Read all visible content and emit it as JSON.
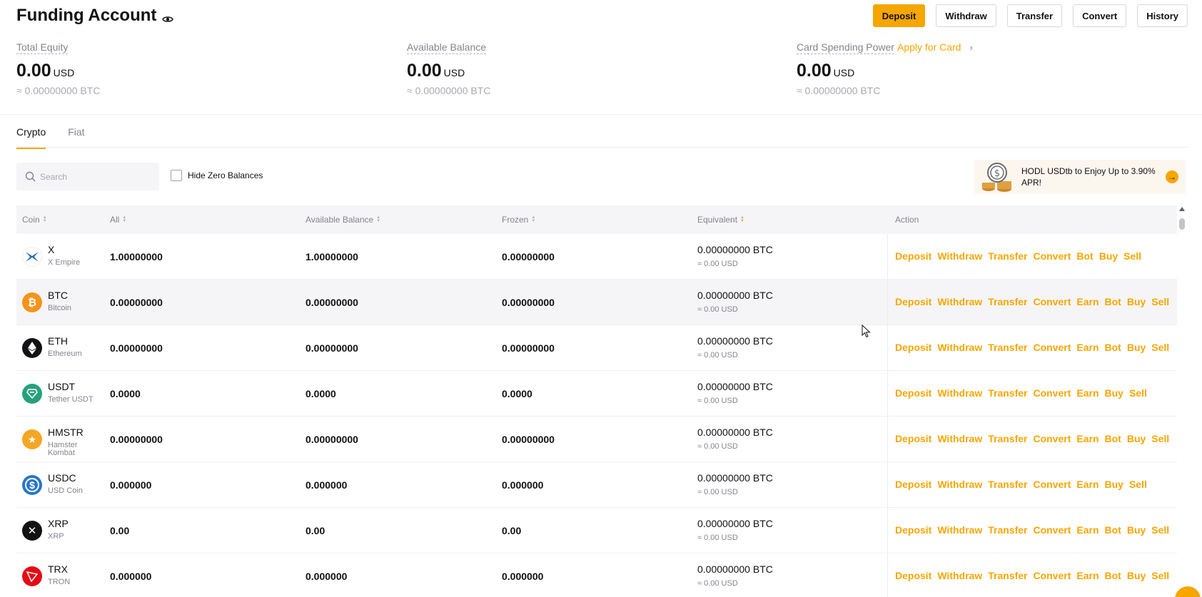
{
  "header": {
    "title": "Funding Account",
    "buttons": {
      "deposit": "Deposit",
      "withdraw": "Withdraw",
      "transfer": "Transfer",
      "convert": "Convert",
      "history": "History"
    }
  },
  "summary": {
    "total_equity": {
      "label": "Total Equity",
      "value": "0.00",
      "unit": "USD",
      "btc": "≈ 0.00000000 BTC"
    },
    "available_balance": {
      "label": "Available Balance",
      "value": "0.00",
      "unit": "USD",
      "btc": "≈ 0.00000000 BTC"
    },
    "card_spending": {
      "label": "Card Spending Power",
      "link": "Apply for Card",
      "value": "0.00",
      "unit": "USD",
      "btc": "≈ 0.00000000 BTC"
    }
  },
  "tabs": [
    "Crypto",
    "Fiat"
  ],
  "search": {
    "placeholder": "Search"
  },
  "hide_zero": "Hide Zero Balances",
  "promo": {
    "text": "HODL USDtb to Enjoy Up to 3.90% APR!"
  },
  "table": {
    "headers": [
      "Coin",
      "All",
      "Available Balance",
      "Frozen",
      "Equivalent",
      "Action"
    ],
    "rows": [
      {
        "symbol": "X",
        "name": "X Empire",
        "all": "1.00000000",
        "available": "1.00000000",
        "frozen": "0.00000000",
        "eq_btc": "0.00000000 BTC",
        "eq_usd": "≈ 0.00 USD",
        "actions": [
          "Deposit",
          "Withdraw",
          "Transfer",
          "Convert",
          "Bot",
          "Buy",
          "Sell"
        ],
        "icon": "x-empire-icon",
        "color": "#ffffff"
      },
      {
        "symbol": "BTC",
        "name": "Bitcoin",
        "all": "0.00000000",
        "available": "0.00000000",
        "frozen": "0.00000000",
        "eq_btc": "0.00000000 BTC",
        "eq_usd": "≈ 0.00 USD",
        "actions": [
          "Deposit",
          "Withdraw",
          "Transfer",
          "Convert",
          "Earn",
          "Bot",
          "Buy",
          "Sell"
        ],
        "icon": "bitcoin-icon",
        "color": "#f7931a"
      },
      {
        "symbol": "ETH",
        "name": "Ethereum",
        "all": "0.00000000",
        "available": "0.00000000",
        "frozen": "0.00000000",
        "eq_btc": "0.00000000 BTC",
        "eq_usd": "≈ 0.00 USD",
        "actions": [
          "Deposit",
          "Withdraw",
          "Transfer",
          "Convert",
          "Earn",
          "Bot",
          "Buy",
          "Sell"
        ],
        "icon": "ethereum-icon",
        "color": "#121214"
      },
      {
        "symbol": "USDT",
        "name": "Tether USDT",
        "all": "0.0000",
        "available": "0.0000",
        "frozen": "0.0000",
        "eq_btc": "0.00000000 BTC",
        "eq_usd": "≈ 0.00 USD",
        "actions": [
          "Deposit",
          "Withdraw",
          "Transfer",
          "Convert",
          "Earn",
          "Buy",
          "Sell"
        ],
        "icon": "tether-icon",
        "color": "#26a17b"
      },
      {
        "symbol": "HMSTR",
        "name": "Hamster Kombat",
        "all": "0.00000000",
        "available": "0.00000000",
        "frozen": "0.00000000",
        "eq_btc": "0.00000000 BTC",
        "eq_usd": "≈ 0.00 USD",
        "actions": [
          "Deposit",
          "Withdraw",
          "Transfer",
          "Convert",
          "Earn",
          "Bot",
          "Buy",
          "Sell"
        ],
        "icon": "hamster-icon",
        "color": "#f5a623"
      },
      {
        "symbol": "USDC",
        "name": "USD Coin",
        "all": "0.000000",
        "available": "0.000000",
        "frozen": "0.000000",
        "eq_btc": "0.00000000 BTC",
        "eq_usd": "≈ 0.00 USD",
        "actions": [
          "Deposit",
          "Withdraw",
          "Transfer",
          "Convert",
          "Earn",
          "Buy",
          "Sell"
        ],
        "icon": "usdc-icon",
        "color": "#2775ca"
      },
      {
        "symbol": "XRP",
        "name": "XRP",
        "all": "0.00",
        "available": "0.00",
        "frozen": "0.00",
        "eq_btc": "0.00000000 BTC",
        "eq_usd": "≈ 0.00 USD",
        "actions": [
          "Deposit",
          "Withdraw",
          "Transfer",
          "Convert",
          "Earn",
          "Bot",
          "Buy",
          "Sell"
        ],
        "icon": "xrp-icon",
        "color": "#121214"
      },
      {
        "symbol": "TRX",
        "name": "TRON",
        "all": "0.000000",
        "available": "0.000000",
        "frozen": "0.000000",
        "eq_btc": "0.00000000 BTC",
        "eq_usd": "≈ 0.00 USD",
        "actions": [
          "Deposit",
          "Withdraw",
          "Transfer",
          "Convert",
          "Earn",
          "Bot",
          "Buy",
          "Sell"
        ],
        "icon": "tron-icon",
        "color": "#e50915"
      }
    ]
  },
  "colors": {
    "accent": "#f7a600",
    "text": "#121214",
    "muted": "#81858c"
  }
}
